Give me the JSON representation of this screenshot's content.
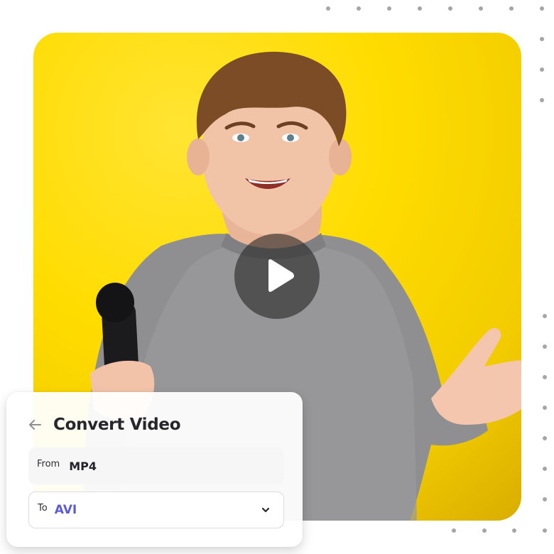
{
  "hero": {
    "image_description": "Smiling teen boy in grey sweater holding a microphone against a yellow background",
    "background_color": "#ffdc00",
    "play_icon": "play-icon"
  },
  "convert_card": {
    "back_icon": "arrow-left-icon",
    "title": "Convert Video",
    "from": {
      "label": "From",
      "value": "MP4"
    },
    "to": {
      "label": "To",
      "value": "AVI",
      "dropdown_icon": "chevron-down-icon"
    },
    "accent_color": "#5a5bd6"
  },
  "decoration": {
    "dot_color": "#a6a6a8"
  }
}
